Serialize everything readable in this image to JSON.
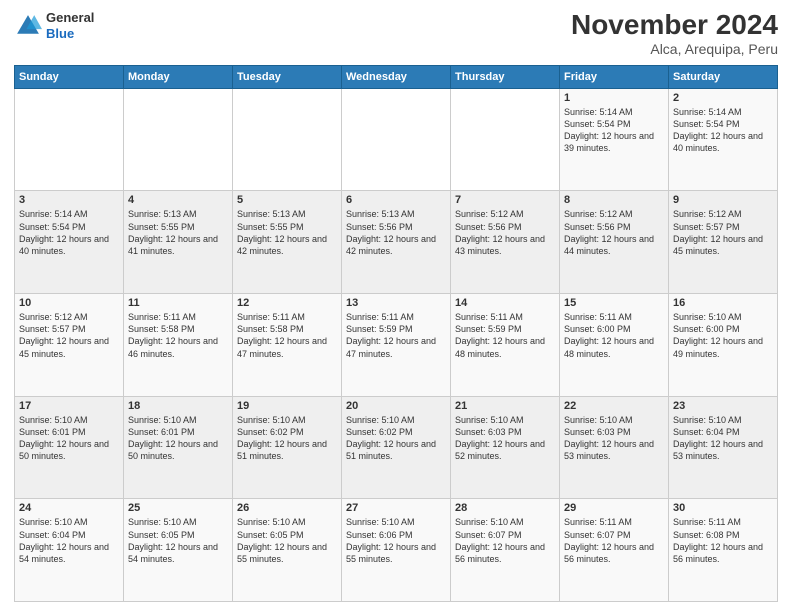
{
  "header": {
    "logo_line1": "General",
    "logo_line2": "Blue",
    "month": "November 2024",
    "location": "Alca, Arequipa, Peru"
  },
  "weekdays": [
    "Sunday",
    "Monday",
    "Tuesday",
    "Wednesday",
    "Thursday",
    "Friday",
    "Saturday"
  ],
  "weeks": [
    [
      {
        "day": "",
        "info": ""
      },
      {
        "day": "",
        "info": ""
      },
      {
        "day": "",
        "info": ""
      },
      {
        "day": "",
        "info": ""
      },
      {
        "day": "",
        "info": ""
      },
      {
        "day": "1",
        "info": "Sunrise: 5:14 AM\nSunset: 5:54 PM\nDaylight: 12 hours and 39 minutes."
      },
      {
        "day": "2",
        "info": "Sunrise: 5:14 AM\nSunset: 5:54 PM\nDaylight: 12 hours and 40 minutes."
      }
    ],
    [
      {
        "day": "3",
        "info": "Sunrise: 5:14 AM\nSunset: 5:54 PM\nDaylight: 12 hours and 40 minutes."
      },
      {
        "day": "4",
        "info": "Sunrise: 5:13 AM\nSunset: 5:55 PM\nDaylight: 12 hours and 41 minutes."
      },
      {
        "day": "5",
        "info": "Sunrise: 5:13 AM\nSunset: 5:55 PM\nDaylight: 12 hours and 42 minutes."
      },
      {
        "day": "6",
        "info": "Sunrise: 5:13 AM\nSunset: 5:56 PM\nDaylight: 12 hours and 42 minutes."
      },
      {
        "day": "7",
        "info": "Sunrise: 5:12 AM\nSunset: 5:56 PM\nDaylight: 12 hours and 43 minutes."
      },
      {
        "day": "8",
        "info": "Sunrise: 5:12 AM\nSunset: 5:56 PM\nDaylight: 12 hours and 44 minutes."
      },
      {
        "day": "9",
        "info": "Sunrise: 5:12 AM\nSunset: 5:57 PM\nDaylight: 12 hours and 45 minutes."
      }
    ],
    [
      {
        "day": "10",
        "info": "Sunrise: 5:12 AM\nSunset: 5:57 PM\nDaylight: 12 hours and 45 minutes."
      },
      {
        "day": "11",
        "info": "Sunrise: 5:11 AM\nSunset: 5:58 PM\nDaylight: 12 hours and 46 minutes."
      },
      {
        "day": "12",
        "info": "Sunrise: 5:11 AM\nSunset: 5:58 PM\nDaylight: 12 hours and 47 minutes."
      },
      {
        "day": "13",
        "info": "Sunrise: 5:11 AM\nSunset: 5:59 PM\nDaylight: 12 hours and 47 minutes."
      },
      {
        "day": "14",
        "info": "Sunrise: 5:11 AM\nSunset: 5:59 PM\nDaylight: 12 hours and 48 minutes."
      },
      {
        "day": "15",
        "info": "Sunrise: 5:11 AM\nSunset: 6:00 PM\nDaylight: 12 hours and 48 minutes."
      },
      {
        "day": "16",
        "info": "Sunrise: 5:10 AM\nSunset: 6:00 PM\nDaylight: 12 hours and 49 minutes."
      }
    ],
    [
      {
        "day": "17",
        "info": "Sunrise: 5:10 AM\nSunset: 6:01 PM\nDaylight: 12 hours and 50 minutes."
      },
      {
        "day": "18",
        "info": "Sunrise: 5:10 AM\nSunset: 6:01 PM\nDaylight: 12 hours and 50 minutes."
      },
      {
        "day": "19",
        "info": "Sunrise: 5:10 AM\nSunset: 6:02 PM\nDaylight: 12 hours and 51 minutes."
      },
      {
        "day": "20",
        "info": "Sunrise: 5:10 AM\nSunset: 6:02 PM\nDaylight: 12 hours and 51 minutes."
      },
      {
        "day": "21",
        "info": "Sunrise: 5:10 AM\nSunset: 6:03 PM\nDaylight: 12 hours and 52 minutes."
      },
      {
        "day": "22",
        "info": "Sunrise: 5:10 AM\nSunset: 6:03 PM\nDaylight: 12 hours and 53 minutes."
      },
      {
        "day": "23",
        "info": "Sunrise: 5:10 AM\nSunset: 6:04 PM\nDaylight: 12 hours and 53 minutes."
      }
    ],
    [
      {
        "day": "24",
        "info": "Sunrise: 5:10 AM\nSunset: 6:04 PM\nDaylight: 12 hours and 54 minutes."
      },
      {
        "day": "25",
        "info": "Sunrise: 5:10 AM\nSunset: 6:05 PM\nDaylight: 12 hours and 54 minutes."
      },
      {
        "day": "26",
        "info": "Sunrise: 5:10 AM\nSunset: 6:05 PM\nDaylight: 12 hours and 55 minutes."
      },
      {
        "day": "27",
        "info": "Sunrise: 5:10 AM\nSunset: 6:06 PM\nDaylight: 12 hours and 55 minutes."
      },
      {
        "day": "28",
        "info": "Sunrise: 5:10 AM\nSunset: 6:07 PM\nDaylight: 12 hours and 56 minutes."
      },
      {
        "day": "29",
        "info": "Sunrise: 5:11 AM\nSunset: 6:07 PM\nDaylight: 12 hours and 56 minutes."
      },
      {
        "day": "30",
        "info": "Sunrise: 5:11 AM\nSunset: 6:08 PM\nDaylight: 12 hours and 56 minutes."
      }
    ]
  ]
}
